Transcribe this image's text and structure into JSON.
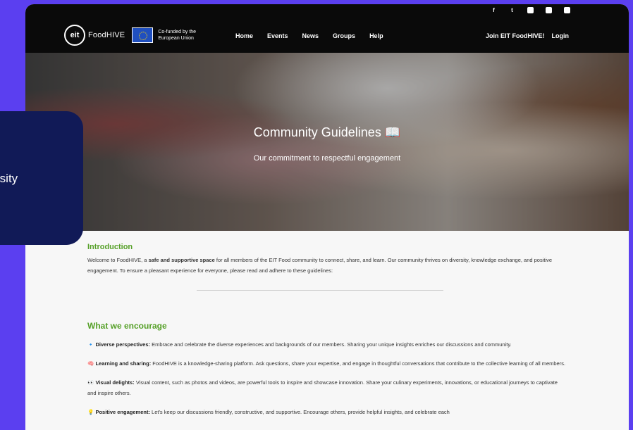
{
  "social": [
    "f",
    "t",
    "ig",
    "in",
    "yt"
  ],
  "brand": {
    "logo": "eit",
    "name": "FoodHIVE",
    "eu_text": "Co-funded by the European Union"
  },
  "nav": [
    "Home",
    "Events",
    "News",
    "Groups",
    "Help"
  ],
  "right_links": [
    "Join EIT FoodHIVE!",
    "Login"
  ],
  "hero": {
    "title": "Community Guidelines 📖",
    "subtitle": "Our commitment to respectful engagement"
  },
  "intro": {
    "heading": "Introduction",
    "pre": "Welcome to FoodHIVE, a ",
    "bold": "safe and supportive space",
    "post": " for all members of the EIT Food community to connect, share, and learn. Our community thrives on diversity, knowledge exchange, and positive engagement. To ensure a pleasant experience for everyone, please read and adhere to these guidelines:"
  },
  "encourage": {
    "heading": "What we encourage",
    "items": [
      {
        "icon": "🔹",
        "title": "Diverse perspectives:",
        "text": " Embrace and celebrate the diverse experiences and backgrounds of our members. Sharing your unique insights enriches our discussions and community."
      },
      {
        "icon": "🧠",
        "title": "Learning and sharing:",
        "text": " FoodHIVE is a knowledge-sharing platform. Ask questions, share your expertise, and engage in thoughtful conversations that contribute to the collective learning of all members."
      },
      {
        "icon": "👀",
        "title": "Visual delights:",
        "text": " Visual content, such as photos and videos, are powerful tools to inspire and showcase innovation. Share your culinary experiments, innovations, or educational journeys to captivate and inspire others."
      },
      {
        "icon": "💡",
        "title": "Positive engagement:",
        "text": " Let's keep our discussions friendly, constructive, and supportive. Encourage others, provide helpful insights, and celebrate each"
      }
    ]
  },
  "overlay_text": "rsity"
}
